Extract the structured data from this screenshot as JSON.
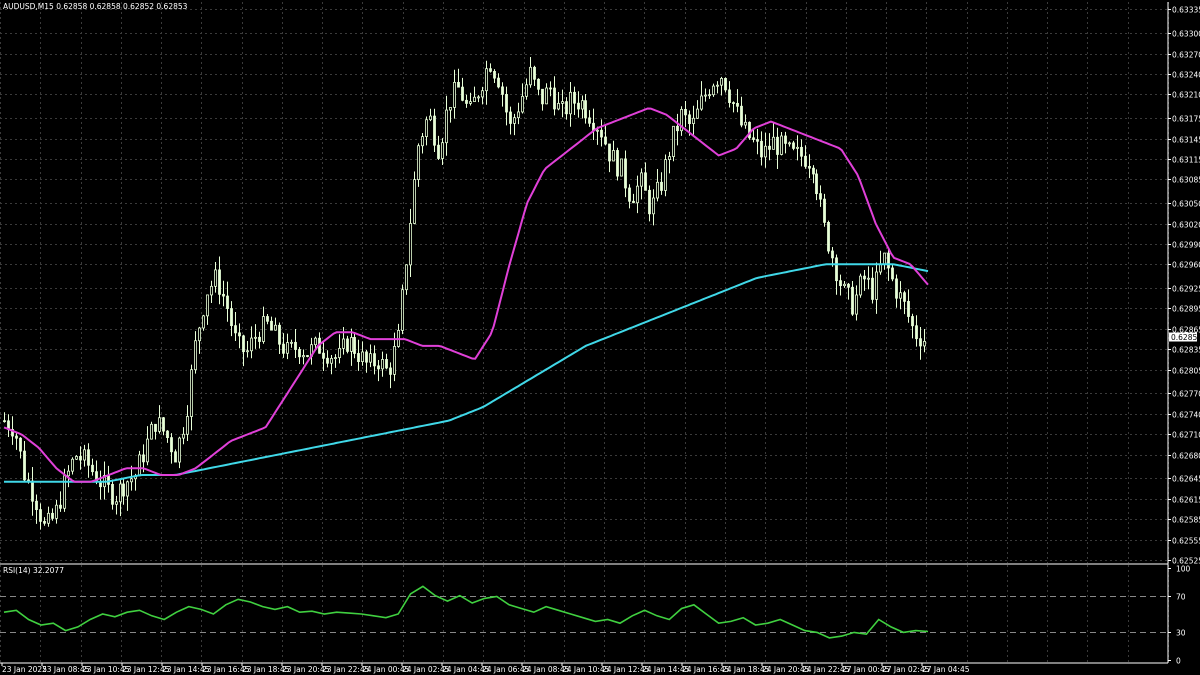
{
  "header": {
    "symbol_info": "AUDUSD,M15  0.62858 0.62858 0.62852 0.62853",
    "rsi_info": "RSI(14) 32.2077"
  },
  "colors": {
    "background": "#000000",
    "grid": "#3a3a3a",
    "candle": "#e8ffd8",
    "ma_fast": "#e040d8",
    "ma_slow": "#40d8e8",
    "rsi": "#40d040",
    "price_tag_bg": "#ffffff"
  },
  "chart_data": {
    "type": "line",
    "price_axis_ticks": [
      "0.63335",
      "0.63300",
      "0.63270",
      "0.63240",
      "0.63210",
      "0.63175",
      "0.63145",
      "0.63115",
      "0.63085",
      "0.63050",
      "0.63020",
      "0.62990",
      "0.62960",
      "0.62925",
      "0.62895",
      "0.62865",
      "0.62835",
      "0.62805",
      "0.62770",
      "0.62740",
      "0.62710",
      "0.62680",
      "0.62645",
      "0.62615",
      "0.62585",
      "0.62555",
      "0.62525"
    ],
    "ylim": [
      0.62525,
      0.6334
    ],
    "current_price": "0.62853",
    "time_axis_ticks": [
      "23 Jan 2025",
      "23 Jan 08:45",
      "23 Jan 10:45",
      "23 Jan 12:45",
      "23 Jan 14:45",
      "23 Jan 16:45",
      "23 Jan 18:45",
      "23 Jan 20:45",
      "23 Jan 22:45",
      "24 Jan 00:45",
      "24 Jan 02:45",
      "24 Jan 04:45",
      "24 Jan 06:45",
      "24 Jan 08:45",
      "24 Jan 10:45",
      "24 Jan 12:45",
      "24 Jan 14:45",
      "24 Jan 16:45",
      "24 Jan 18:45",
      "24 Jan 20:45",
      "24 Jan 22:45",
      "27 Jan 00:45",
      "27 Jan 02:45",
      "27 Jan 04:45"
    ],
    "close_path": [
      0.6273,
      0.6272,
      0.6265,
      0.6262,
      0.6257,
      0.6259,
      0.6264,
      0.6268,
      0.6267,
      0.6265,
      0.6263,
      0.6262,
      0.6264,
      0.6265,
      0.6269,
      0.6273,
      0.6271,
      0.6268,
      0.6274,
      0.6285,
      0.6292,
      0.6294,
      0.629,
      0.6284,
      0.6283,
      0.6286,
      0.6287,
      0.6285,
      0.6283,
      0.6284,
      0.6283,
      0.6284,
      0.6283,
      0.6282,
      0.6285,
      0.6283,
      0.6281,
      0.6282,
      0.628,
      0.6285,
      0.63,
      0.6314,
      0.6318,
      0.6313,
      0.632,
      0.6322,
      0.6318,
      0.6322,
      0.6326,
      0.6323,
      0.6316,
      0.632,
      0.6324,
      0.632,
      0.6322,
      0.6318,
      0.632,
      0.632,
      0.6318,
      0.6316,
      0.6312,
      0.631,
      0.6306,
      0.6308,
      0.6304,
      0.6308,
      0.6314,
      0.6318,
      0.6316,
      0.632,
      0.6323,
      0.6324,
      0.632,
      0.6316,
      0.6314,
      0.6312,
      0.6314,
      0.6313,
      0.6312,
      0.6312,
      0.6311,
      0.6302,
      0.6297,
      0.6292,
      0.629,
      0.6294,
      0.6292,
      0.6297,
      0.6293,
      0.629,
      0.6286,
      0.6285
    ],
    "ma_fast_path": [
      0.6272,
      0.6271,
      0.6269,
      0.6266,
      0.6264,
      0.6264,
      0.6265,
      0.6266,
      0.6266,
      0.6265,
      0.6265,
      0.6266,
      0.6268,
      0.627,
      0.6271,
      0.6272,
      0.6276,
      0.628,
      0.6284,
      0.6286,
      0.6286,
      0.6285,
      0.6285,
      0.6285,
      0.6284,
      0.6284,
      0.6283,
      0.6282,
      0.6286,
      0.6296,
      0.6305,
      0.631,
      0.6312,
      0.6314,
      0.6316,
      0.6317,
      0.6318,
      0.6319,
      0.6318,
      0.6316,
      0.6314,
      0.6312,
      0.6313,
      0.6316,
      0.6317,
      0.6316,
      0.6315,
      0.6314,
      0.6313,
      0.6309,
      0.6302,
      0.6297,
      0.6296,
      0.6293
    ],
    "ma_slow_path": [
      0.6264,
      0.6264,
      0.6264,
      0.6264,
      0.6265,
      0.6265,
      0.6266,
      0.6267,
      0.6268,
      0.6269,
      0.627,
      0.6271,
      0.6272,
      0.6273,
      0.6275,
      0.6278,
      0.6281,
      0.6284,
      0.6286,
      0.6288,
      0.629,
      0.6292,
      0.6294,
      0.6295,
      0.6296,
      0.6296,
      0.6296,
      0.6295
    ],
    "rsi": {
      "name": "RSI(14)",
      "value": 32.2077,
      "levels": [
        70,
        30
      ],
      "ylim": [
        0,
        100
      ],
      "axis_ticks": [
        "100",
        "70",
        "30",
        "0"
      ],
      "path": [
        52,
        54,
        44,
        38,
        40,
        32,
        36,
        44,
        50,
        47,
        52,
        54,
        48,
        44,
        52,
        58,
        55,
        50,
        60,
        66,
        63,
        58,
        55,
        58,
        52,
        53,
        50,
        52,
        51,
        50,
        48,
        46,
        50,
        72,
        80,
        70,
        64,
        70,
        62,
        67,
        69,
        60,
        56,
        52,
        58,
        54,
        50,
        46,
        42,
        44,
        40,
        48,
        54,
        48,
        44,
        56,
        60,
        50,
        40,
        42,
        46,
        38,
        40,
        44,
        38,
        32,
        30,
        24,
        26,
        30,
        28,
        44,
        36,
        30,
        32,
        31
      ]
    }
  }
}
